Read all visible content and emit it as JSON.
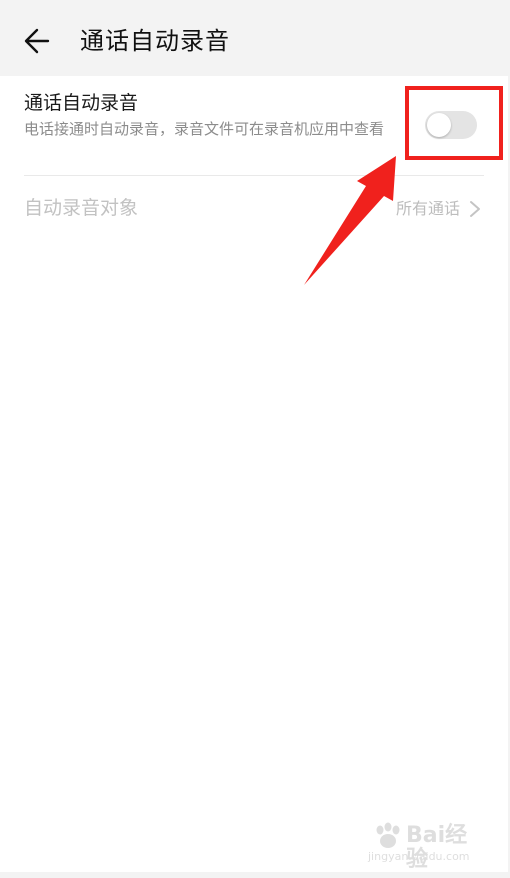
{
  "header": {
    "back_icon": "arrow-left-icon",
    "title": "通话自动录音"
  },
  "auto_record": {
    "title": "通话自动录音",
    "description": "电话接通时自动录音，录音文件可在录音机应用中查看",
    "toggle_state": "off"
  },
  "record_target": {
    "label": "自动录音对象",
    "value": "所有通话",
    "chevron_icon": "chevron-right-icon"
  },
  "annotation": {
    "highlight_color": "#f0211d",
    "arrow_color": "#f0211d"
  },
  "watermark": {
    "brand": "Bai经验",
    "url": "jingyan.baidu.com"
  },
  "colors": {
    "background": "#f3f3f3",
    "card": "#ffffff",
    "toggle_off": "#e4e4e4",
    "disabled_text": "#c2c2c2"
  }
}
